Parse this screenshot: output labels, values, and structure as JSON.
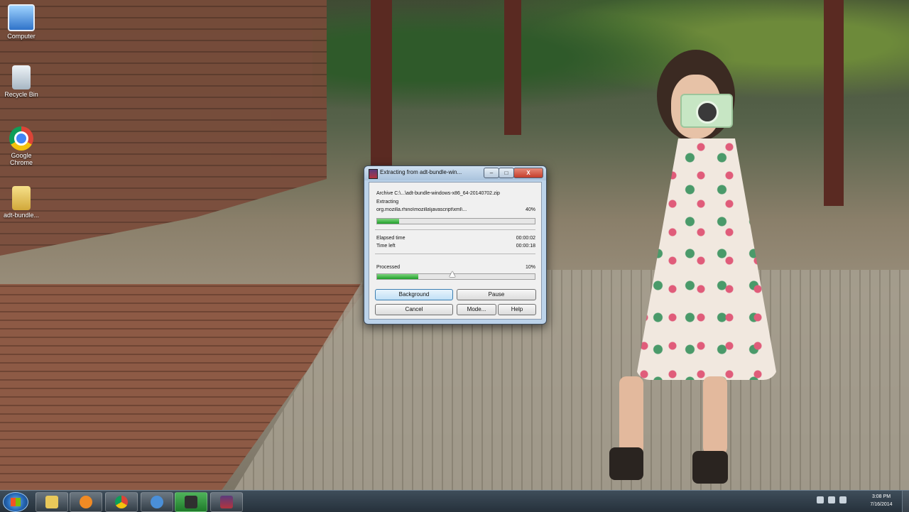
{
  "desktop": {
    "icons": [
      {
        "label": "Computer",
        "icon": "computer-icon"
      },
      {
        "label": "Recycle Bin",
        "icon": "recycle-bin-icon"
      },
      {
        "label": "Google Chrome",
        "icon": "chrome-icon"
      },
      {
        "label": "adt-bundle...",
        "icon": "zip-folder-icon"
      }
    ]
  },
  "dialog": {
    "title": "Extracting from adt-bundle-win...",
    "archive_line": "Archive C:\\...\\adt-bundle-windows-x86_64-20140702.zip",
    "extracting_label": "Extracting",
    "current_file": "org.mozilla.rhino\\mozilla\\javascript\\xml\\...",
    "current_percent": "40%",
    "current_progress": 0.14,
    "elapsed_label": "Elapsed time",
    "elapsed_value": "00:00:02",
    "time_left_label": "Time left",
    "time_left_value": "00:00:18",
    "processed_label": "Processed",
    "processed_percent": "10%",
    "processed_progress": 0.26,
    "buttons": {
      "background": "Background",
      "pause": "Pause",
      "cancel": "Cancel",
      "mode": "Mode...",
      "help": "Help"
    },
    "title_buttons": {
      "minimize": "–",
      "maximize": "□",
      "close": "X"
    }
  },
  "taskbar": {
    "items": [
      {
        "name": "explorer",
        "icon": "folder-icon",
        "color": "#e9c85a"
      },
      {
        "name": "media-player",
        "icon": "media-player-icon",
        "color": "#f08a24"
      },
      {
        "name": "chrome",
        "icon": "chrome-icon",
        "color": "#db4437"
      },
      {
        "name": "ie-like",
        "icon": "globe-icon",
        "color": "#4a8fd8"
      },
      {
        "name": "tool",
        "icon": "tool-icon",
        "color": "#2f2f2f",
        "active": true
      },
      {
        "name": "winrar",
        "icon": "winrar-icon",
        "color": "#8b2b4a"
      }
    ],
    "clock_time": "3:08 PM",
    "clock_date": "7/16/2014"
  }
}
